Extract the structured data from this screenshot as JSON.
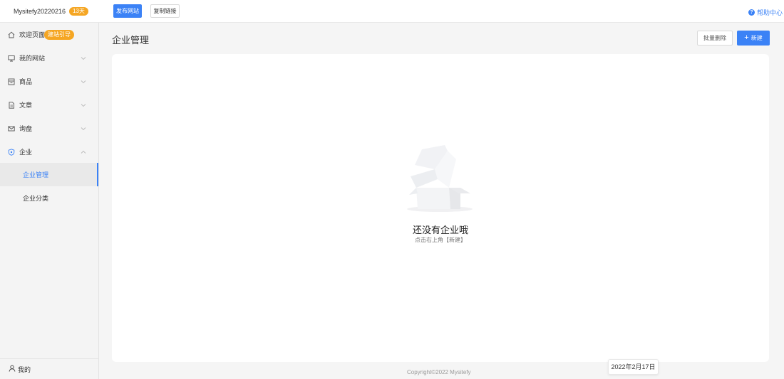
{
  "topbar": {
    "site_name": "Mysitefy20220216",
    "days_badge": "13天",
    "publish_label": "发布网站",
    "copy_link_label": "复制链接",
    "help_label": "帮助中心"
  },
  "sidebar": {
    "items": [
      {
        "label": "欢迎页面",
        "icon": "home-icon",
        "badge": "建站引导"
      },
      {
        "label": "我的网站",
        "icon": "monitor-icon"
      },
      {
        "label": "商品",
        "icon": "product-icon"
      },
      {
        "label": "文章",
        "icon": "document-icon"
      },
      {
        "label": "询盘",
        "icon": "mail-icon"
      },
      {
        "label": "企业",
        "icon": "shield-icon"
      }
    ],
    "sub_items": [
      {
        "label": "企业管理",
        "active": true
      },
      {
        "label": "企业分类",
        "active": false
      }
    ],
    "bottom_label": "我的"
  },
  "main": {
    "title": "企业管理",
    "batch_delete_label": "批量删除",
    "new_label": "新建",
    "empty_title": "还没有企业哦",
    "empty_hint": "点击右上角【新建】"
  },
  "footer": {
    "copyright": "Copyright©2022 Mysitefy",
    "date_tooltip": "2022年2月17日"
  },
  "colors": {
    "accent": "#3b82f6",
    "badge": "#f5a623"
  }
}
